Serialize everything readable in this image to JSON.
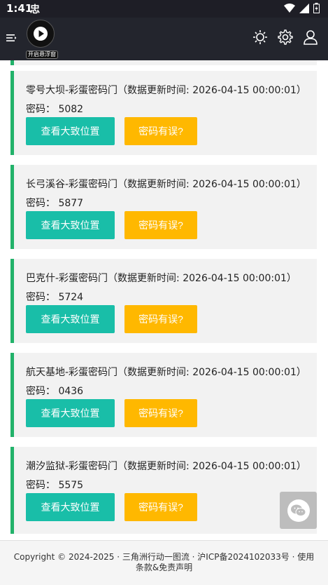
{
  "status_bar": {
    "time": "1:41",
    "app_icon_text": "忠"
  },
  "header": {
    "play_label": "开启悬浮窗"
  },
  "cards": [
    {
      "title": "零号大坝-彩蛋密码门（数据更新时间: 2026-04-15 00:00:01）",
      "code": "密码：  5082",
      "locate_label": "查看大致位置",
      "error_label": "密码有误?"
    },
    {
      "title": "长弓溪谷-彩蛋密码门（数据更新时间: 2026-04-15 00:00:01）",
      "code": "密码：  5877",
      "locate_label": "查看大致位置",
      "error_label": "密码有误?"
    },
    {
      "title": "巴克什-彩蛋密码门（数据更新时间: 2026-04-15 00:00:01）",
      "code": "密码：  5724",
      "locate_label": "查看大致位置",
      "error_label": "密码有误?"
    },
    {
      "title": "航天基地-彩蛋密码门（数据更新时间: 2026-04-15 00:00:01）",
      "code": "密码：  0436",
      "locate_label": "查看大致位置",
      "error_label": "密码有误?"
    },
    {
      "title": "潮汐监狱-彩蛋密码门（数据更新时间: 2026-04-15 00:00:01）",
      "code": "密码：  5575",
      "locate_label": "查看大致位置",
      "error_label": "密码有误?"
    }
  ],
  "footer": {
    "text": "Copyright © 2024-2025 · 三角洲行动一图流 · 沪ICP备2024102033号 · 使用条款&免责声明"
  },
  "colors": {
    "accent_green": "#22b26a",
    "teal_button": "#19bea8",
    "amber_button": "#ffb800",
    "header_bg": "#23252d"
  }
}
